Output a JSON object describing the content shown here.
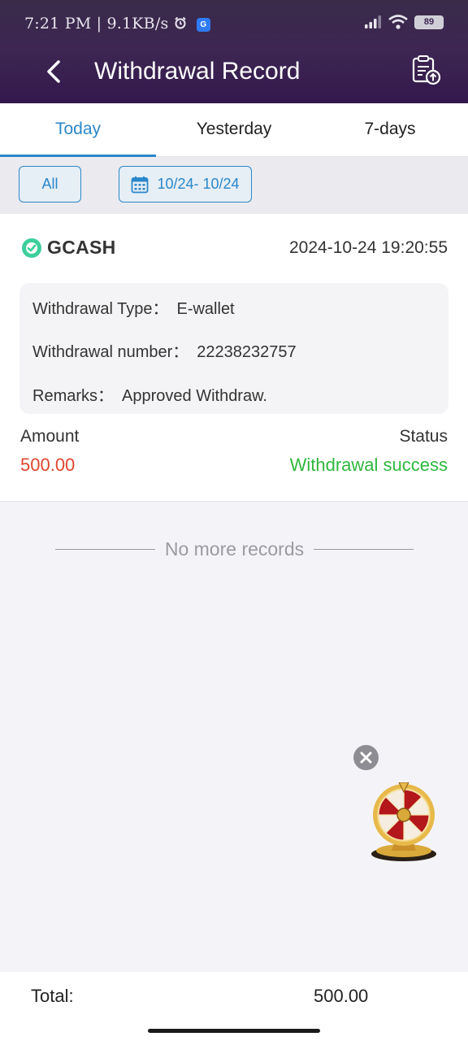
{
  "status_bar": {
    "time": "7:21 PM",
    "separator": "|",
    "net_speed": "9.1KB/s",
    "g_badge": "G",
    "battery": "89",
    "icons": [
      "alarm-icon",
      "signal-icon",
      "wifi-icon",
      "battery-icon"
    ]
  },
  "header": {
    "title": "Withdrawal Record",
    "back_icon": "chevron-left-icon",
    "action_icon": "clipboard-upload-icon"
  },
  "tabs": [
    {
      "label": "Today",
      "active": true
    },
    {
      "label": "Yesterday",
      "active": false
    },
    {
      "label": "7-days",
      "active": false
    }
  ],
  "filters": {
    "all_label": "All",
    "date_range": "10/24- 10/24",
    "date_icon": "calendar-icon"
  },
  "record": {
    "provider": "GCASH",
    "datetime": "2024-10-24 19:20:55",
    "details": [
      {
        "label": "Withdrawal Type：",
        "value": "E-wallet"
      },
      {
        "label": "Withdrawal number：",
        "value": "22238232757"
      },
      {
        "label": "Remarks：",
        "value": "Approved Withdraw."
      }
    ],
    "amount_label": "Amount",
    "amount": "500.00",
    "status_label": "Status",
    "status": "Withdrawal success"
  },
  "list_end_text": "No more records",
  "floating": {
    "close_icon": "close-icon",
    "wheel_icon": "prize-wheel-icon"
  },
  "footer": {
    "total_label": "Total:",
    "total_value": "500.00"
  },
  "colors": {
    "header_bg": "#3d2652",
    "accent": "#2a87c9",
    "amount": "#e0452f",
    "success": "#2fb83e"
  }
}
